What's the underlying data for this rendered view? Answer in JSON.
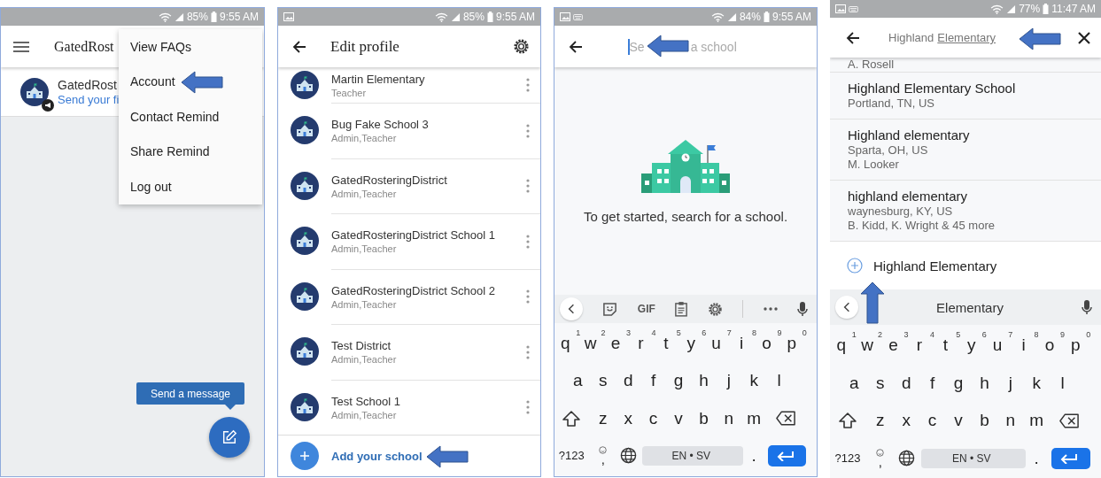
{
  "phones": [
    {
      "kind": "home",
      "status": {
        "battery": "85%",
        "time": "9:55 AM"
      },
      "app_bar": {
        "title": "GatedRost"
      },
      "class_row": {
        "name": "GatedRost",
        "subtitle": "Send your fi"
      },
      "menu": [
        "View FAQs",
        "Account",
        "Contact Remind",
        "Share Remind",
        "Log out"
      ],
      "tooltip": "Send a message"
    },
    {
      "kind": "profile",
      "status": {
        "notifications": [
          {
            "kind": "image"
          }
        ],
        "battery": "85%",
        "time": "9:55 AM"
      },
      "app_bar": {
        "title": "Edit profile"
      },
      "schools": [
        {
          "name": "Martin Elementary",
          "role": "Teacher"
        },
        {
          "name": "Bug Fake School 3",
          "role": "Admin,Teacher"
        },
        {
          "name": "GatedRosteringDistrict",
          "role": "Admin,Teacher"
        },
        {
          "name": "GatedRosteringDistrict School 1",
          "role": "Admin,Teacher"
        },
        {
          "name": "GatedRosteringDistrict School 2",
          "role": "Admin,Teacher"
        },
        {
          "name": "Test District",
          "role": "Admin,Teacher"
        },
        {
          "name": "Test School 1",
          "role": "Admin,Teacher"
        }
      ],
      "add_label": "Add your school"
    },
    {
      "kind": "search",
      "status": {
        "notifications": [
          {
            "kind": "image"
          },
          {
            "kind": "keyboard"
          }
        ],
        "battery": "84%",
        "time": "9:55 AM"
      },
      "search": {
        "placeholder_start": "Se",
        "placeholder_end": "a school"
      },
      "message": "To get started, search for a school.",
      "keyboard": {
        "toolbar": [
          {
            "kind": "collapse"
          },
          {
            "kind": "sticker"
          },
          {
            "kind": "gif",
            "label": "GIF"
          },
          {
            "kind": "clipboard"
          },
          {
            "kind": "settings"
          },
          {
            "kind": "more"
          },
          {
            "kind": "mic"
          }
        ],
        "rows": [
          {
            "keys": [
              {
                "label": "q",
                "hint": "1"
              },
              {
                "label": "w",
                "hint": "2"
              },
              {
                "label": "e",
                "hint": "3"
              },
              {
                "label": "r",
                "hint": "4"
              },
              {
                "label": "t",
                "hint": "5"
              },
              {
                "label": "y",
                "hint": "6"
              },
              {
                "label": "u",
                "hint": "7"
              },
              {
                "label": "i",
                "hint": "8"
              },
              {
                "label": "o",
                "hint": "9"
              },
              {
                "label": "p",
                "hint": "0"
              }
            ]
          },
          {
            "keys": [
              {
                "label": "a"
              },
              {
                "label": "s"
              },
              {
                "label": "d"
              },
              {
                "label": "f"
              },
              {
                "label": "g"
              },
              {
                "label": "h"
              },
              {
                "label": "j"
              },
              {
                "label": "k"
              },
              {
                "label": "l"
              }
            ]
          },
          {
            "keys": [
              {
                "kind": "shift"
              },
              {
                "label": "z"
              },
              {
                "label": "x"
              },
              {
                "label": "c"
              },
              {
                "label": "v"
              },
              {
                "label": "b"
              },
              {
                "label": "n"
              },
              {
                "label": "m"
              },
              {
                "kind": "backspace"
              }
            ]
          },
          {
            "keys": [
              {
                "label": "?123"
              },
              {
                "kind": "emoji",
                "label": ","
              },
              {
                "kind": "globe"
              },
              {
                "kind": "space",
                "label": "EN • SV"
              },
              {
                "label": "."
              },
              {
                "kind": "enter"
              }
            ]
          }
        ]
      }
    },
    {
      "kind": "results",
      "status": {
        "notifications": [
          {
            "kind": "image"
          },
          {
            "kind": "keyboard"
          }
        ],
        "battery": "77%",
        "time": "11:47 AM"
      },
      "search": {
        "value": "Highland",
        "composing": "Elementary"
      },
      "results": [
        {
          "lines": [
            "A. Rosell"
          ]
        },
        {
          "title": "Highland Elementary School",
          "lines": [
            "Portland, TN, US"
          ]
        },
        {
          "title": "Highland elementary",
          "lines": [
            "Sparta, OH, US",
            "M. Looker"
          ]
        },
        {
          "title": "highland elementary",
          "lines": [
            "waynesburg, KY, US",
            "B. Kidd, K. Wright & 45 more"
          ]
        }
      ],
      "add_label": "Highland Elementary",
      "keyboard": {
        "toolbar": [
          {
            "kind": "collapse"
          },
          {
            "kind": "suggestion",
            "label": "Elementary"
          },
          {
            "kind": "mic"
          }
        ],
        "rows": [
          {
            "keys": [
              {
                "label": "q",
                "hint": "1"
              },
              {
                "label": "w",
                "hint": "2"
              },
              {
                "label": "e",
                "hint": "3"
              },
              {
                "label": "r",
                "hint": "4"
              },
              {
                "label": "t",
                "hint": "5"
              },
              {
                "label": "y",
                "hint": "6"
              },
              {
                "label": "u",
                "hint": "7"
              },
              {
                "label": "i",
                "hint": "8"
              },
              {
                "label": "o",
                "hint": "9"
              },
              {
                "label": "p",
                "hint": "0"
              }
            ]
          },
          {
            "keys": [
              {
                "label": "a"
              },
              {
                "label": "s"
              },
              {
                "label": "d"
              },
              {
                "label": "f"
              },
              {
                "label": "g"
              },
              {
                "label": "h"
              },
              {
                "label": "j"
              },
              {
                "label": "k"
              },
              {
                "label": "l"
              }
            ]
          },
          {
            "keys": [
              {
                "kind": "shift"
              },
              {
                "label": "z"
              },
              {
                "label": "x"
              },
              {
                "label": "c"
              },
              {
                "label": "v"
              },
              {
                "label": "b"
              },
              {
                "label": "n"
              },
              {
                "label": "m"
              },
              {
                "kind": "backspace"
              }
            ]
          },
          {
            "keys": [
              {
                "label": "?123"
              },
              {
                "kind": "emoji",
                "label": ","
              },
              {
                "kind": "globe"
              },
              {
                "kind": "space",
                "label": "EN • SV"
              },
              {
                "label": "."
              },
              {
                "kind": "enter"
              }
            ]
          }
        ]
      }
    }
  ]
}
